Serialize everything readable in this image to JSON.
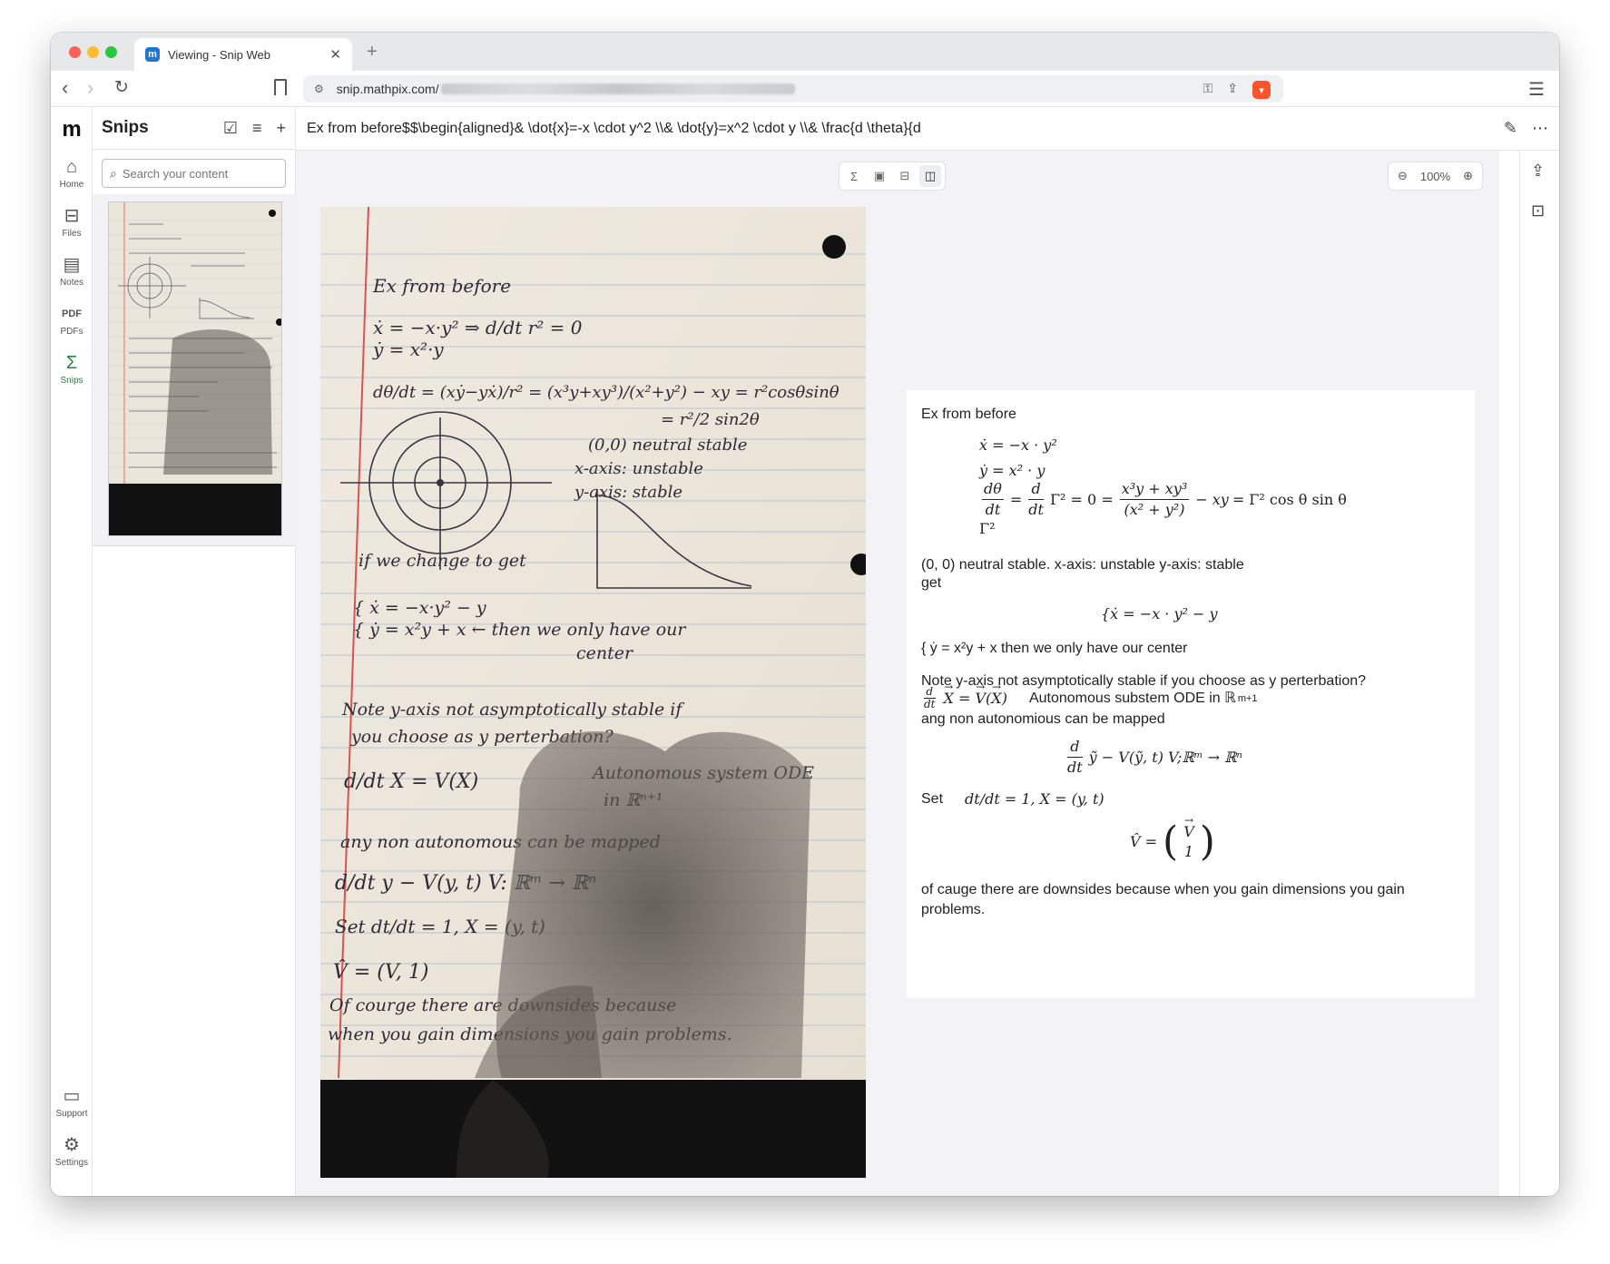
{
  "browser": {
    "tab_title": "Viewing - Snip Web",
    "tab_favicon": "m",
    "url_text": "snip.mathpix.com/"
  },
  "rail": {
    "items": [
      {
        "label": "Home",
        "icon": "home-icon"
      },
      {
        "label": "Files",
        "icon": "files-icon"
      },
      {
        "label": "Notes",
        "icon": "notes-icon"
      },
      {
        "label": "PDFs",
        "icon": "pdf-icon"
      },
      {
        "label": "Snips",
        "icon": "sigma-icon"
      }
    ],
    "support_label": "Support",
    "settings_label": "Settings",
    "active": "Snips"
  },
  "snips": {
    "title": "Snips",
    "search_placeholder": "Search your content"
  },
  "header": {
    "title": "Ex from before$$\\begin{aligned}& \\dot{x}=-x \\cdot y^2 \\\\& \\dot{y}=x^2 \\cdot y \\\\& \\frac{d \\theta}{d"
  },
  "viewer": {
    "zoom_level": "100%",
    "view_modes": [
      "math",
      "image",
      "split-horizontal",
      "split-vertical"
    ],
    "active_mode": "split-vertical"
  },
  "rendered": {
    "line1": "Ex from before",
    "eq1a": "ẋ = −x · y²",
    "eq1b": "ẏ = x² · y",
    "eq1c_rhs": "= Γ² cos θ sin θ",
    "eq1d": "Γ²",
    "line2": "(0, 0) neutral stable. x-axis: unstable y-axis: stable",
    "line3": "get",
    "eq2": "{ẋ = −x · y² − y",
    "line4": "{ ẏ = x²y + x then we only have our center",
    "line5": "Note y-axis not asymptotically stable if you choose as y perterbation?",
    "line6_text": "Autonomous substem ODE in ℝ",
    "line6_sup": "m+1",
    "line7": "ang non autonomious can be mapped",
    "eq3": "ỹ − V(ỹ, t)    V;ℝᵐ → ℝⁿ",
    "line8_label": "Set",
    "line8_eq": "dt/dt = 1,    X = (y, t)",
    "eq4": "V̂ =",
    "line9": "of cauge there are downsides because when you gain dimensions you gain problems."
  },
  "photo_text": {
    "l1": "Ex from before",
    "l2": "if we change to get",
    "l3": "then we only have our center",
    "l4": "Note y-axis not asymptotically stable if you choose as y perterbation?",
    "l5": "Autonomous system ODE in R",
    "l6": "any non autonomous can be mapped",
    "l7": "Of courge there are downsides because when you gain dimensions you gain problems.",
    "l8": "(0,0) neutral stable",
    "l9": "x-axis: unstable",
    "l10": "y-axis: stable"
  },
  "colors": {
    "accent_green": "#1f8a3a",
    "paper": "#ebe6dc",
    "rule_line": "#b9c3cf",
    "margin_line": "#d9534f"
  }
}
